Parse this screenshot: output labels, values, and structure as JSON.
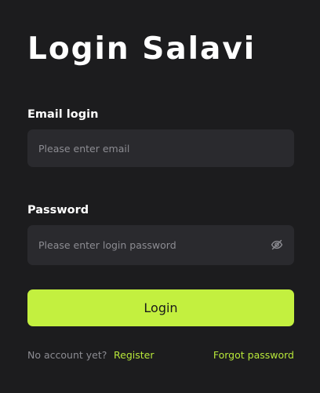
{
  "header": {
    "title": "Login Salavi"
  },
  "form": {
    "email": {
      "label": "Email login",
      "placeholder": "Please enter email",
      "value": ""
    },
    "password": {
      "label": "Password",
      "placeholder": "Please enter login password",
      "value": "",
      "toggle_icon": "eye-off-icon"
    },
    "submit_label": "Login"
  },
  "footer": {
    "no_account_text": "No account yet?",
    "register_label": "Register",
    "forgot_label": "Forgot password"
  },
  "colors": {
    "background": "#1c1c1e",
    "input_background": "#2a2a2e",
    "accent": "#c3f03f",
    "link": "#b8e83a",
    "muted_text": "#8c8c92"
  }
}
